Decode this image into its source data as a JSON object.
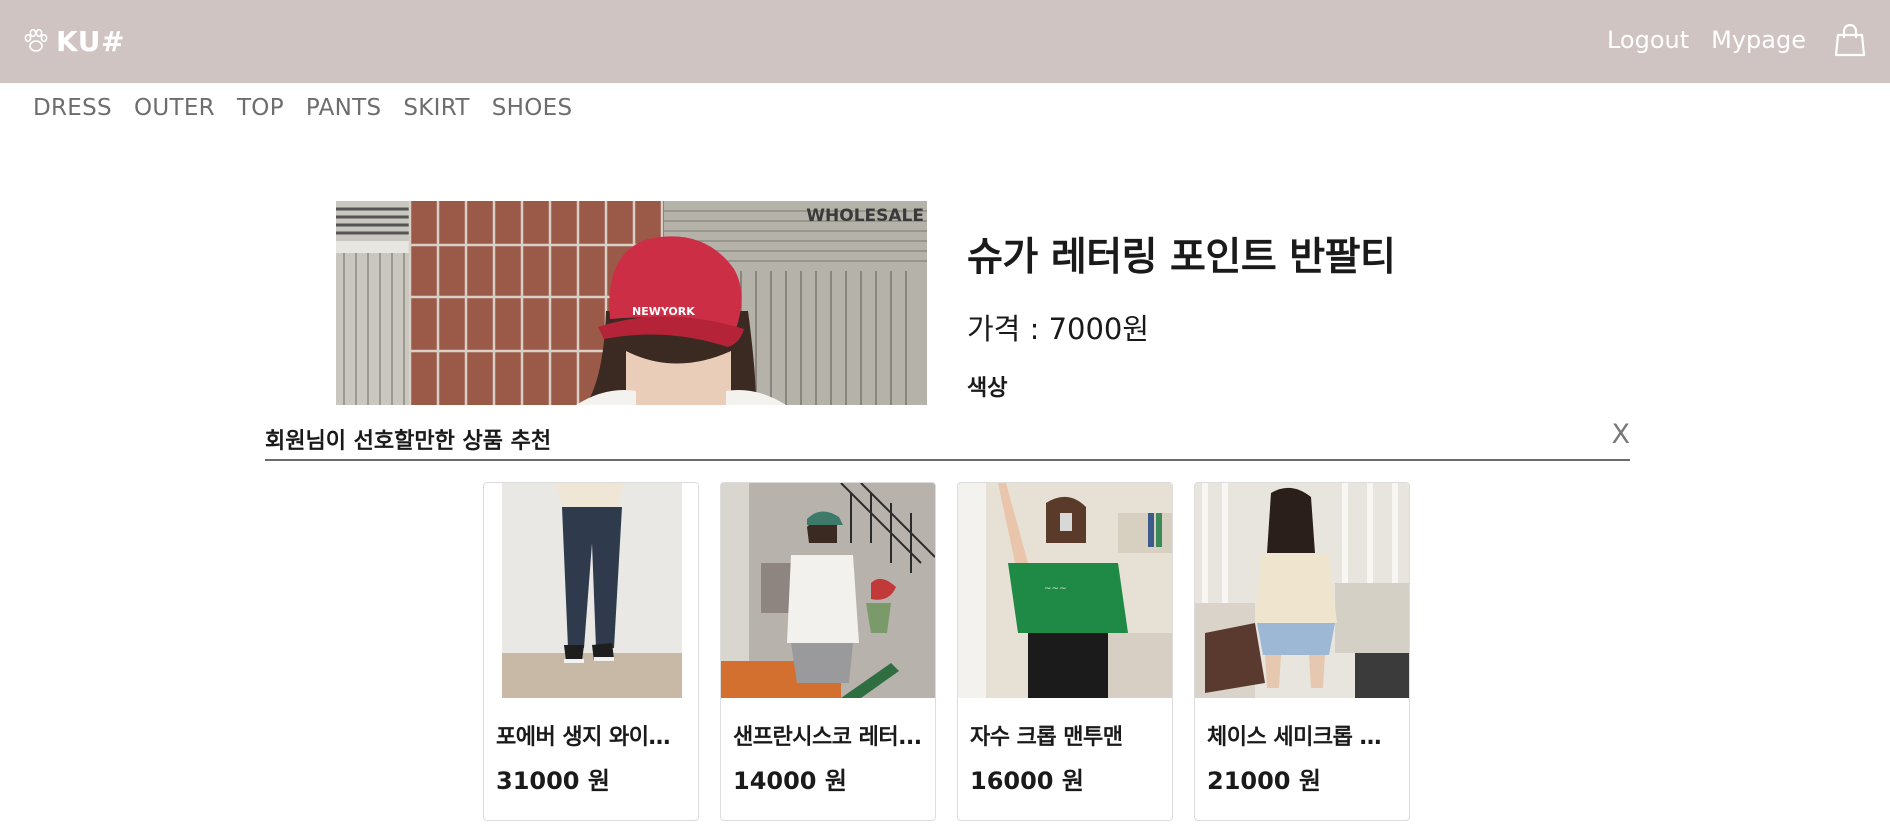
{
  "header": {
    "logo_text": "KU#",
    "logout_label": "Logout",
    "mypage_label": "Mypage",
    "icons": {
      "logo": "paw-icon",
      "cart": "shopping-bag-icon"
    },
    "background_color": "#cfc4c1"
  },
  "categories": [
    "DRESS",
    "OUTER",
    "TOP",
    "PANTS",
    "SKIRT",
    "SHOES"
  ],
  "product": {
    "title": "슈가 레터링 포인트 반팔티",
    "price": "가격 : 7000원",
    "color_label": "색상",
    "image_text": "WHOLESALE",
    "cap_text": "NEWYORK"
  },
  "recommendations": {
    "title": "회원님이 선호할만한 상품 추천",
    "close_label": "X",
    "items": [
      {
        "name": "포에버 생지 와이드 ...",
        "price": "31000 원"
      },
      {
        "name": "샌프란시스코 레터...",
        "price": "14000 원"
      },
      {
        "name": "자수 크롭 맨투맨",
        "price": "16000 원"
      },
      {
        "name": "체이스 세미크롭 니트",
        "price": "21000 원"
      }
    ]
  }
}
